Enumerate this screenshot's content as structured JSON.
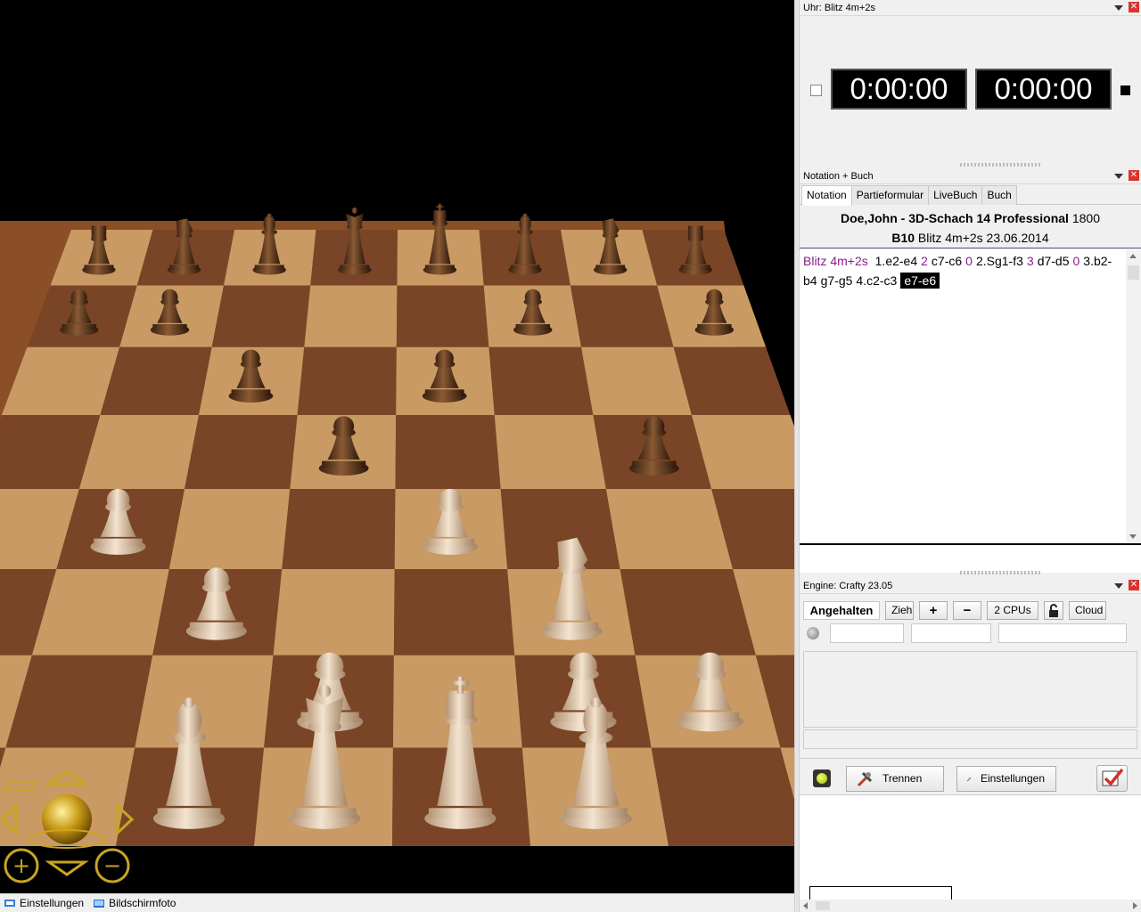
{
  "clock": {
    "title": "Uhr: Blitz 4m+2s",
    "white_time": "0:00:00",
    "black_time": "0:00:00"
  },
  "notation": {
    "title": "Notation + Buch",
    "tabs": [
      "Notation",
      "Partieformular",
      "LiveBuch",
      "Buch"
    ],
    "active_tab": "Notation",
    "header": {
      "players": "Doe,John - 3D-Schach 14 Professional",
      "rating": "1800",
      "eco": "B10",
      "event_date": "Blitz 4m+2s 23.06.2014"
    },
    "time_control": "Blitz 4m+2s",
    "moves": [
      {
        "text": "1.e2-e4",
        "time": "2"
      },
      {
        "text": "c7-c6",
        "time": "0"
      },
      {
        "text": "2.Sg1-f3",
        "time": "3"
      },
      {
        "text": "d7-d5",
        "time": "0"
      },
      {
        "text": "3.b2-b4",
        "time": ""
      },
      {
        "text": "g7-g5",
        "time": ""
      },
      {
        "text": "4.c2-c3",
        "time": ""
      },
      {
        "text": "e7-e6",
        "time": "",
        "selected": true
      }
    ]
  },
  "engine": {
    "title": "Engine: Crafty 23.05",
    "status_button": "Angehalten",
    "move_button": "Zieh",
    "plus_button": "+",
    "minus_button": "−",
    "cpus_button": "2 CPUs",
    "cloud_button": "Cloud"
  },
  "server": {
    "disconnect_button": "Trennen",
    "settings_button": "Einstellungen"
  },
  "status_bar": {
    "settings": "Einstellungen",
    "screenshot": "Bildschirmfoto"
  },
  "colors": {
    "board_dark": "#7a4526",
    "board_light": "#c99a63",
    "board_frame": "#8b4f28",
    "time_purple": "#8a1c8a",
    "close_red": "#d9342b"
  },
  "icons": [
    "chevron-down-icon",
    "close-icon",
    "plus-icon",
    "minus-icon",
    "lock-icon",
    "tools-icon",
    "wrench-icon",
    "checkmark-icon",
    "zoom-in-icon",
    "zoom-out-icon",
    "rotate-left-icon",
    "rotate-right-icon",
    "camera-icon",
    "settings-icon"
  ]
}
